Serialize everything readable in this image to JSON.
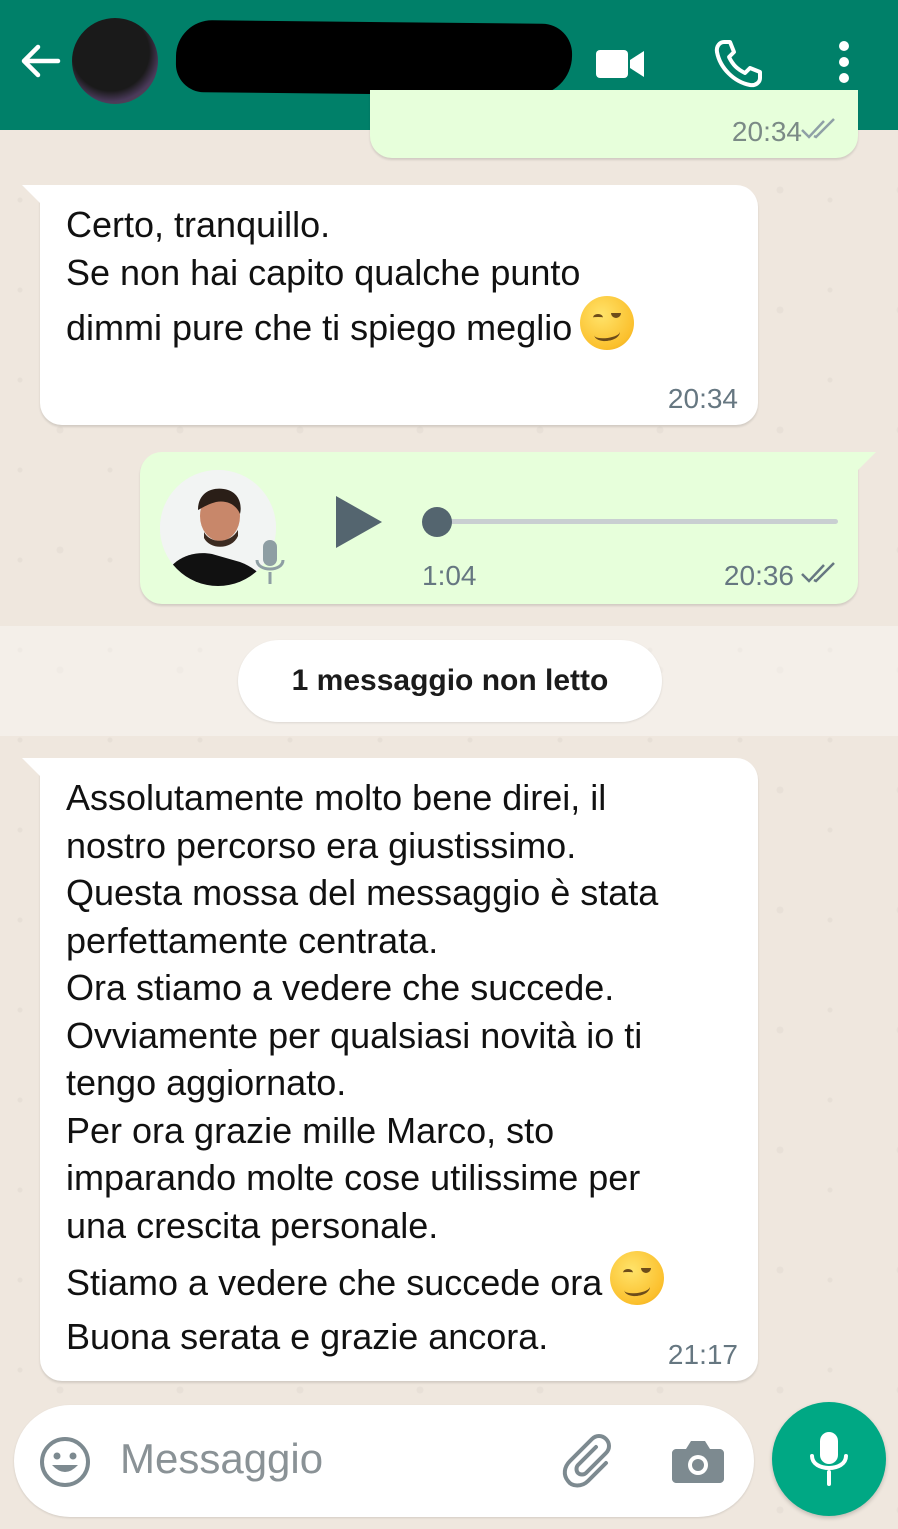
{
  "header": {
    "contact_name": "",
    "back_icon": "arrow-left-icon",
    "video_icon": "videocam-icon",
    "call_icon": "phone-icon",
    "menu_icon": "more-vert-icon",
    "color": "#008069"
  },
  "messages": [
    {
      "direction": "outgoing",
      "time": "20:34",
      "status": "read"
    },
    {
      "direction": "incoming",
      "lines": [
        "Certo, tranquillo.",
        "Se non hai capito qualche punto",
        "dimmi pure che ti spiego meglio"
      ],
      "emoji": "wink-smile",
      "time": "20:34"
    },
    {
      "direction": "outgoing",
      "type": "voice",
      "duration": "1:04",
      "progress": 0,
      "time": "20:36",
      "status": "sent"
    },
    {
      "direction": "incoming",
      "lines": [
        "Assolutamente molto bene direi, il",
        "nostro percorso era giustissimo.",
        "Questa mossa del messaggio è stata",
        "perfettamente centrata.",
        "Ora stiamo a vedere che succede.",
        "Ovviamente per qualsiasi novità io ti",
        "tengo aggiornato.",
        "Per ora grazie mille Marco, sto",
        "imparando molte cose utilissime per",
        "una crescita personale."
      ],
      "line_emoji": "Stiamo a vedere che succede ora",
      "last_line": "Buona serata e grazie ancora.",
      "time": "21:17"
    }
  ],
  "unread_banner": "1 messaggio non letto",
  "composer": {
    "placeholder": "Messaggio",
    "emoji_icon": "emoji-smiley-icon",
    "attach_icon": "paperclip-icon",
    "camera_icon": "camera-icon",
    "send_icon": "microphone-icon",
    "accent": "#00a884"
  }
}
